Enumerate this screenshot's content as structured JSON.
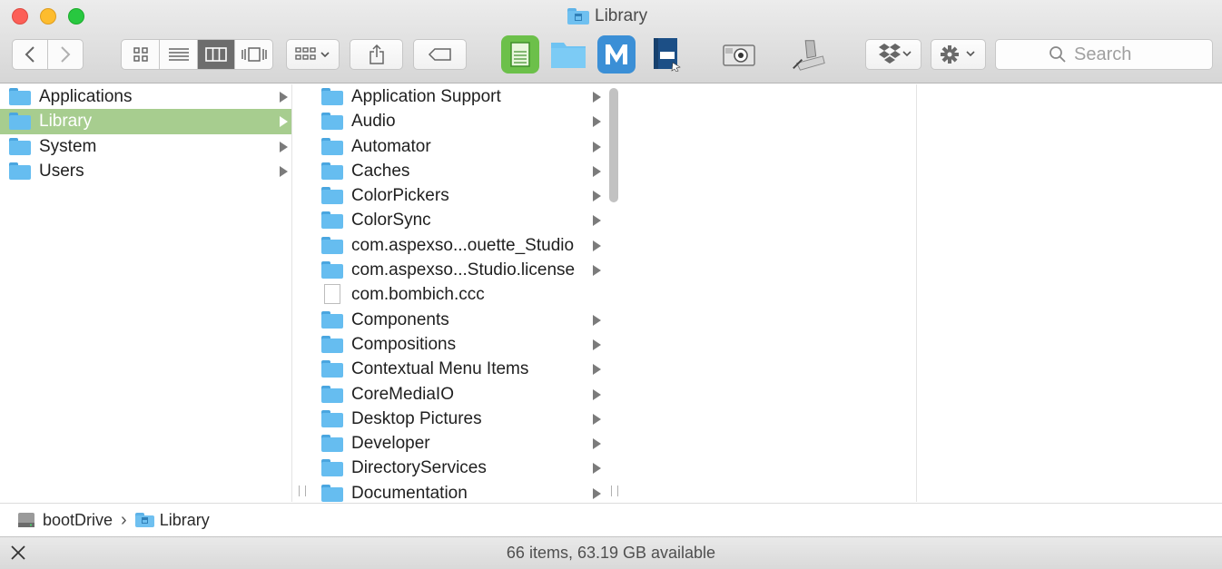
{
  "window": {
    "title": "Library",
    "toolbar": {
      "search_placeholder": "Search",
      "app_icons": [
        "ledger-app-icon",
        "folder-icon",
        "m-app-icon",
        "user-guide-book-icon",
        "image-capture-icon",
        "microscope-icon"
      ]
    }
  },
  "columns": {
    "root": [
      {
        "label": "Applications",
        "selected": false
      },
      {
        "label": "Library",
        "selected": true
      },
      {
        "label": "System",
        "selected": false
      },
      {
        "label": "Users",
        "selected": false
      }
    ],
    "library": [
      {
        "label": "Application Support",
        "kind": "folder"
      },
      {
        "label": "Audio",
        "kind": "folder"
      },
      {
        "label": "Automator",
        "kind": "folder"
      },
      {
        "label": "Caches",
        "kind": "folder"
      },
      {
        "label": "ColorPickers",
        "kind": "folder"
      },
      {
        "label": "ColorSync",
        "kind": "folder"
      },
      {
        "label": "com.aspexso...ouette_Studio",
        "kind": "folder"
      },
      {
        "label": "com.aspexso...Studio.license",
        "kind": "folder"
      },
      {
        "label": "com.bombich.ccc",
        "kind": "file"
      },
      {
        "label": "Components",
        "kind": "folder"
      },
      {
        "label": "Compositions",
        "kind": "folder"
      },
      {
        "label": "Contextual Menu Items",
        "kind": "folder"
      },
      {
        "label": "CoreMediaIO",
        "kind": "folder"
      },
      {
        "label": "Desktop Pictures",
        "kind": "folder"
      },
      {
        "label": "Developer",
        "kind": "folder"
      },
      {
        "label": "DirectoryServices",
        "kind": "folder"
      },
      {
        "label": "Documentation",
        "kind": "folder"
      }
    ]
  },
  "pathbar": {
    "drive": "bootDrive",
    "separator": "›",
    "folder": "Library"
  },
  "status": "66 items, 63.19 GB available",
  "colors": {
    "selection": "#a7cd8f",
    "folder": "#66bdf0",
    "close": "#fc5f57",
    "minimize": "#fdbc2e",
    "zoom": "#28c840"
  }
}
